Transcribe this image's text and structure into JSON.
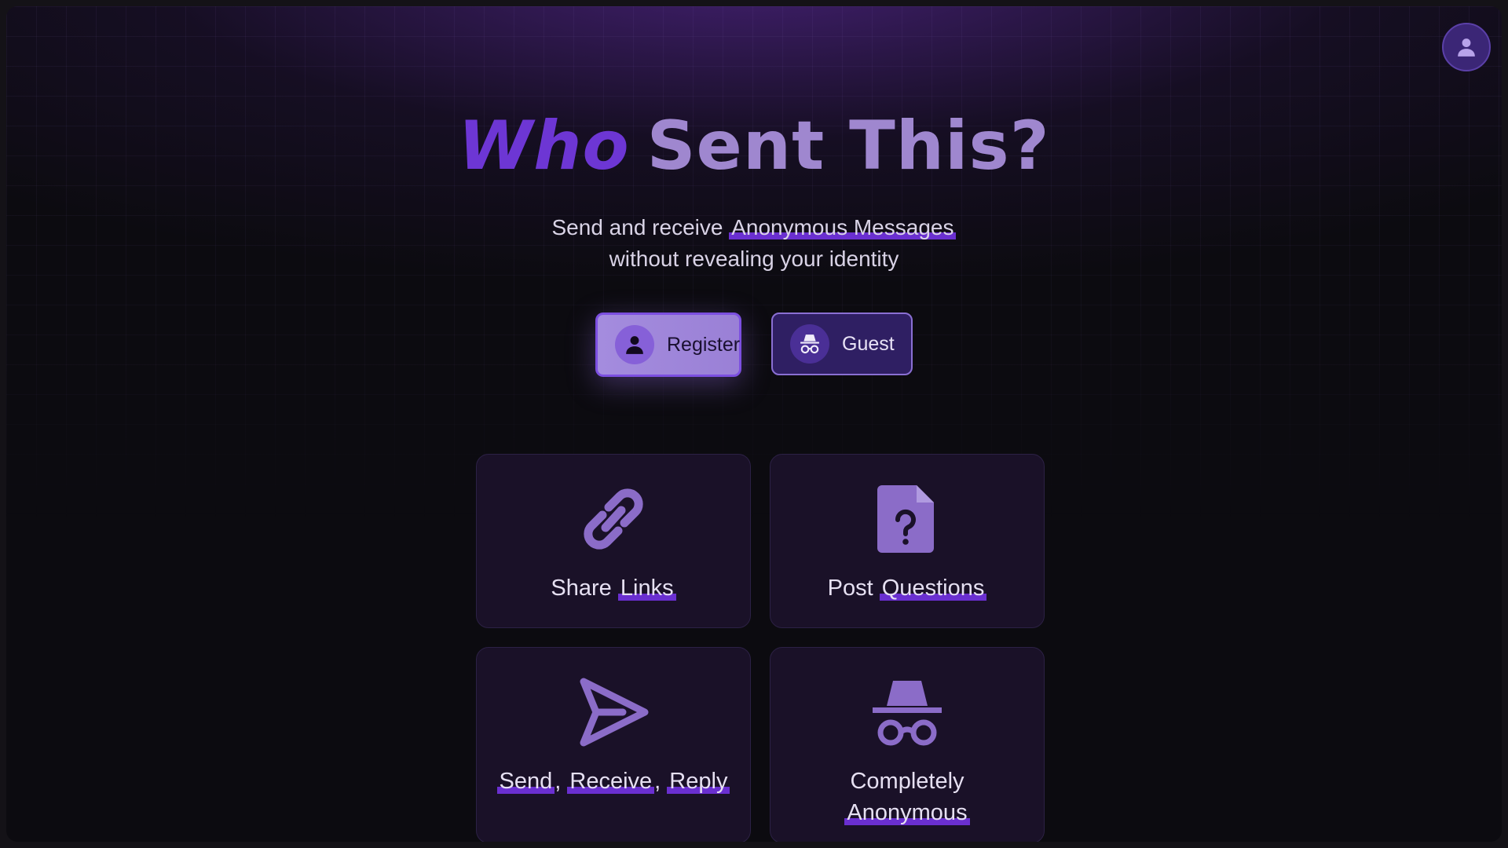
{
  "title": {
    "word1": "Who",
    "rest": "Sent This?"
  },
  "subtitle": {
    "line1_prefix": "Send and receive ",
    "line1_highlight": "Anonymous Messages",
    "line2": "without revealing your identity"
  },
  "buttons": {
    "register": "Register",
    "guest": "Guest"
  },
  "features": {
    "share": {
      "prefix": "Share ",
      "highlight": "Links"
    },
    "post": {
      "prefix": "Post ",
      "highlight": "Questions"
    },
    "send": {
      "w1": "Send",
      "sep1": ",",
      "w2": "Receive",
      "sep2": ",",
      "w3": "Reply"
    },
    "anon": {
      "line1": "Completely",
      "highlight": "Anonymous"
    }
  },
  "icons": {
    "profile": "user-icon",
    "register": "user-icon",
    "guest": "incognito-icon",
    "share": "link-icon",
    "post": "question-file-icon",
    "send": "send-icon",
    "anon": "incognito-icon"
  },
  "colors": {
    "accent": "#6d36d4",
    "accent_light": "#9f87cf",
    "background": "#0c0b10"
  }
}
